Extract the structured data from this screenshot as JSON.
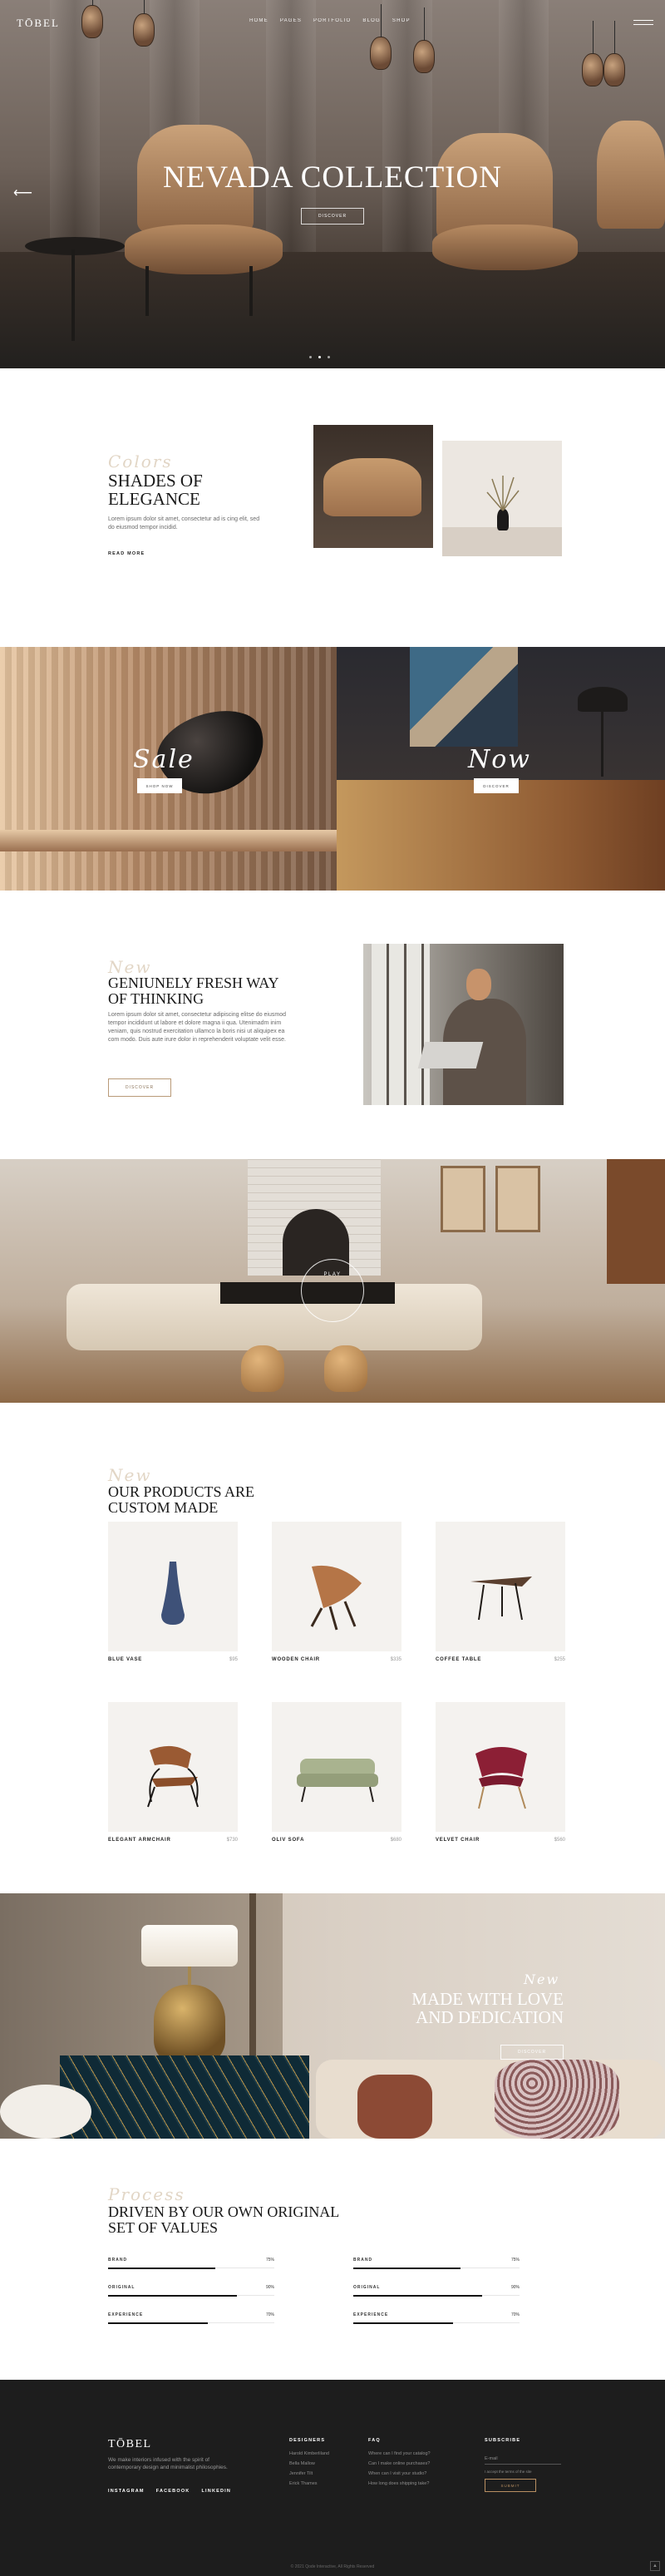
{
  "header": {
    "logo": "TŌBEL",
    "menu": [
      "HOME",
      "PAGES",
      "PORTFOLIO",
      "BLOG",
      "SHOP"
    ],
    "menu_icon": "hamburger-icon"
  },
  "hero": {
    "title": "NEVADA COLLECTION",
    "button": "DISCOVER",
    "prev_icon": "arrow-left-icon"
  },
  "shades": {
    "eyebrow": "Colors",
    "title_1": "SHADES OF",
    "title_2": "ELEGANCE",
    "body": "Lorem ipsum dolor sit amet, consectetur ad is cing elit, sed do eiusmod tempor incidid.",
    "link": "READ MORE"
  },
  "promo": {
    "sale_word": "Sale",
    "sale_button": "SHOP NOW",
    "now_word": "Now",
    "now_button": "DISCOVER"
  },
  "fresh": {
    "eyebrow": "New",
    "title_1": "GENIUNELY FRESH WAY",
    "title_2": "OF THINKING",
    "body": "Lorem ipsum dolor sit amet, consectetur adipiscing elitse do eiusmod tempor incididunt ut labore et dolore magna ii qua. Utenimadm inim veniam, quis nostrud exercitation ullamco la boris nisi ut aliquipex ea com modo. Duis aute irure dolor in reprehenderit voluptate velit esse.",
    "button": "DISCOVER"
  },
  "video": {
    "label": "PLAY",
    "icon": "play-icon"
  },
  "products": {
    "eyebrow": "New",
    "title_1": "OUR PRODUCTS ARE",
    "title_2": "CUSTOM MADE",
    "items": [
      {
        "name": "BLUE VASE",
        "price": "$95"
      },
      {
        "name": "WOODEN CHAIR",
        "price": "$335"
      },
      {
        "name": "COFFEE TABLE",
        "price": "$255"
      },
      {
        "name": "ELEGANT ARMCHAIR",
        "price": "$730"
      },
      {
        "name": "OLIV SOFA",
        "price": "$680"
      },
      {
        "name": "VELVET CHAIR",
        "price": "$560"
      }
    ]
  },
  "dedication": {
    "eyebrow": "New",
    "title_1": "MADE WITH LOVE",
    "title_2": "AND DEDICATION",
    "button": "DISCOVER"
  },
  "values": {
    "eyebrow": "Process",
    "title_1": "DRIVEN BY OUR OWN ORIGINAL",
    "title_2": "SET OF VALUES",
    "bars_left": [
      {
        "label": "BRAND",
        "pct": "75%",
        "value": 0.75
      },
      {
        "label": "ORIGINAL",
        "pct": "90%",
        "value": 0.9
      },
      {
        "label": "EXPERIENCE",
        "pct": "70%",
        "value": 0.7
      }
    ],
    "bars_right": [
      {
        "label": "BRAND",
        "pct": "75%",
        "value": 0.75
      },
      {
        "label": "ORIGINAL",
        "pct": "90%",
        "value": 0.9
      },
      {
        "label": "EXPERIENCE",
        "pct": "70%",
        "value": 0.7
      }
    ]
  },
  "footer": {
    "logo": "TŌBEL",
    "desc": "We make interiors infused with the spirit of contemporary design and minimalist philosophies.",
    "social": [
      "INSTAGRAM",
      "FACEBOOK",
      "LINKEDIN"
    ],
    "designers_title": "DESIGNERS",
    "designers": [
      "Harold Kimberliland",
      "Bella Mallow",
      "Jennifer Tilt",
      "Erick Thames"
    ],
    "faq_title": "FAQ",
    "faq": [
      "Where can I find your catalog?",
      "Can I make online purchases?",
      "When can I visit your studio?",
      "How long does shipping take?"
    ],
    "subscribe_title": "SUBSCRIBE",
    "email_placeholder": "E-mail",
    "privacy": "I accept the terms of the site",
    "submit": "SUBMIT",
    "copyright": "© 2021 Qode Interactive, All Rights Reserved",
    "up_icon": "arrow-up-icon"
  },
  "colors": {
    "accent": "#b88f62",
    "footer_bg": "#1d1d1d",
    "script": "#e2d6c6"
  }
}
